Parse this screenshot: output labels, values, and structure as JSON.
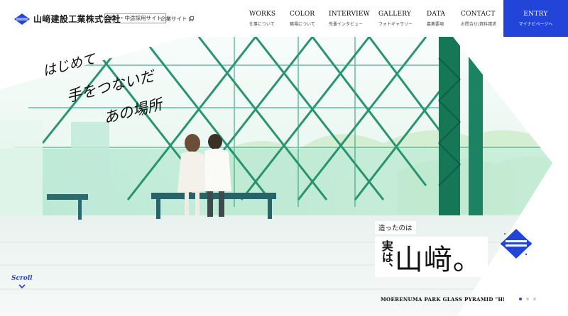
{
  "header": {
    "company_name": "山﨑建設工業株式会社",
    "recruit_tag": "新卒・中途採用サイト",
    "corporate_link": "企業サイト"
  },
  "nav": [
    {
      "en": "WORKS",
      "ja": "仕事について"
    },
    {
      "en": "COLOR",
      "ja": "職場について"
    },
    {
      "en": "INTERVIEW",
      "ja": "先輩インタビュー"
    },
    {
      "en": "GALLERY",
      "ja": "フォトギャラリー"
    },
    {
      "en": "DATA",
      "ja": "募集要項"
    },
    {
      "en": "CONTACT",
      "ja": "お問合せ/資料請求"
    }
  ],
  "entry": {
    "en": "ENTRY",
    "ja": "マイナビページへ"
  },
  "hero": {
    "handwriting": [
      "はじめて",
      "手をつないだ",
      "あの場所"
    ],
    "catch_small": "造ったのは",
    "catch_jitsu": "実は、",
    "catch_name": "山﨑。",
    "caption": "MOERENUMA PARK GLASS PYRAMID \"HIDAMARI\"",
    "scroll_label": "Scroll",
    "slide_count": 3,
    "active_slide": 1
  },
  "colors": {
    "brand_blue": "#2244d8",
    "steel_green": "#1f8f6a",
    "glass_mint": "#bfe9d8"
  }
}
